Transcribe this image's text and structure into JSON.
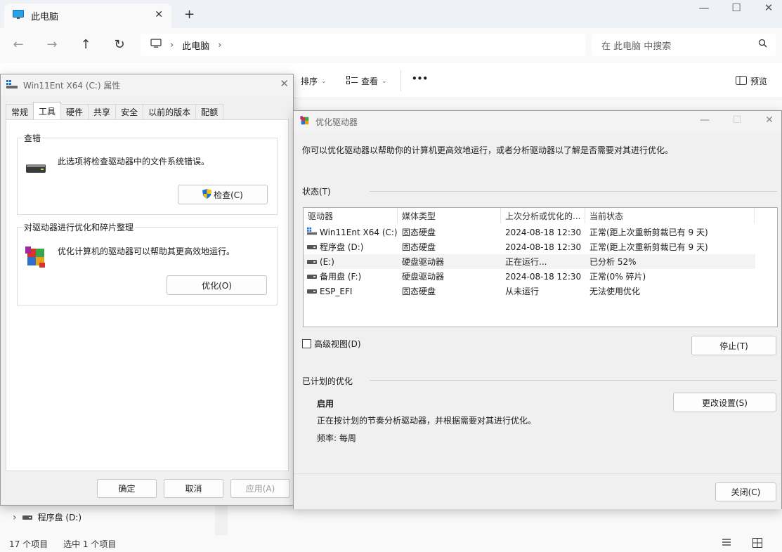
{
  "explorer": {
    "tab_title": "此电脑",
    "tab_close": "✕",
    "tab_add": "+",
    "window_controls": {
      "minimize": "—",
      "maximize": "☐",
      "close": "✕"
    },
    "nav": {
      "back": "←",
      "forward": "→",
      "up": "↑",
      "refresh": "↻"
    },
    "breadcrumb": {
      "location": "此电脑",
      "sep": "›",
      "trail_sep": "›"
    },
    "search_placeholder": "在 此电脑 中搜索",
    "commands": {
      "sort": "排序",
      "view": "查看",
      "more": "•••",
      "preview": "预览",
      "caret": "⌄"
    },
    "nav_pane": {
      "expand": "›",
      "drive": "程序盘 (D:)"
    },
    "status": {
      "items": "17 个项目",
      "selected": "选中 1 个项目"
    }
  },
  "properties": {
    "title": "Win11Ent X64 (C:) 属性",
    "close": "✕",
    "tabs": [
      "常规",
      "工具",
      "硬件",
      "共享",
      "安全",
      "以前的版本",
      "配额"
    ],
    "active_tab": "工具",
    "error_check": {
      "header": "查错",
      "text": "此选项将检查驱动器中的文件系统错误。",
      "button": "检查(C)"
    },
    "optimize": {
      "header": "对驱动器进行优化和碎片整理",
      "text": "优化计算机的驱动器可以帮助其更高效地运行。",
      "button": "优化(O)"
    },
    "buttons": {
      "ok": "确定",
      "cancel": "取消",
      "apply": "应用(A)"
    }
  },
  "optimize_drives": {
    "title": "优化驱动器",
    "controls": {
      "minimize": "—",
      "maximize": "☐",
      "close": "✕"
    },
    "intro": "你可以优化驱动器以帮助你的计算机更高效地运行，或者分析驱动器以了解是否需要对其进行优化。",
    "status_header": "状态(T)",
    "columns": [
      "驱动器",
      "媒体类型",
      "上次分析或优化的...",
      "当前状态"
    ],
    "drives": [
      {
        "name": "Win11Ent X64 (C:)",
        "media": "固态硬盘",
        "last": "2024-08-18 12:30",
        "status": "正常(距上次重新剪裁已有 9 天)",
        "icon": "windows-drive-icon",
        "selected": false
      },
      {
        "name": "程序盘 (D:)",
        "media": "固态硬盘",
        "last": "2024-08-18 12:30",
        "status": "正常(距上次重新剪裁已有 9 天)",
        "icon": "drive-icon",
        "selected": false
      },
      {
        "name": "(E:)",
        "media": "硬盘驱动器",
        "last": "正在运行...",
        "status": "已分析 52%",
        "icon": "drive-icon",
        "selected": true
      },
      {
        "name": "备用盘 (F:)",
        "media": "硬盘驱动器",
        "last": "2024-08-18 12:30",
        "status": "正常(0% 碎片)",
        "icon": "drive-icon",
        "selected": false
      },
      {
        "name": "ESP_EFI",
        "media": "固态硬盘",
        "last": "从未运行",
        "status": "无法使用优化",
        "icon": "drive-icon",
        "selected": false
      }
    ],
    "advanced_view": "高级视图(D)",
    "stop_button": "停止(T)",
    "scheduled_header": "已计划的优化",
    "schedule_state": "启用",
    "schedule_desc": "正在按计划的节奏分析驱动器，并根据需要对其进行优化。",
    "frequency": "频率: 每周",
    "change_settings": "更改设置(S)",
    "close_button": "关闭(C)"
  },
  "colors": {
    "accent": "#0067c0",
    "shield_blue": "#1e6fd9",
    "shield_yellow": "#f5c400"
  }
}
